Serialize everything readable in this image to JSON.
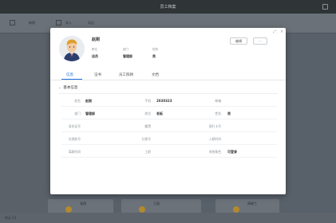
{
  "window": {
    "title": "员工档案"
  },
  "background": {
    "toolbar_items": [
      "新建",
      "导入",
      "导出"
    ],
    "bottom_text": "共计 21",
    "cards": [
      "张翔",
      "王丽",
      "周晓兰"
    ]
  },
  "modal": {
    "profile": {
      "name": "赵刚",
      "fields": [
        {
          "label": "职位",
          "value": "店员"
        },
        {
          "label": "部门",
          "value": "管理部"
        },
        {
          "label": "性别",
          "value": "男"
        }
      ]
    },
    "buttons": {
      "edit": "编辑",
      "more": "···"
    },
    "tabs": [
      "信息",
      "证书",
      "员工照顾",
      "文档"
    ],
    "section_title": "基本信息",
    "rows": [
      [
        {
          "label": "姓名",
          "value": "赵刚"
        },
        {
          "label": "手机",
          "value": "2020323"
        },
        {
          "label": "邮箱",
          "value": ""
        }
      ],
      [
        {
          "label": "部门",
          "value": "管理部"
        },
        {
          "label": "岗位",
          "value": "老板"
        },
        {
          "label": "性别",
          "value": "男"
        }
      ],
      [
        {
          "label": "身份证号",
          "value": ""
        },
        {
          "label": "籍贯",
          "value": ""
        },
        {
          "label": "银行卡号",
          "value": ""
        }
      ],
      [
        {
          "label": "社保账号",
          "value": ""
        },
        {
          "label": "社保号",
          "value": ""
        },
        {
          "label": "入职时间",
          "value": ""
        }
      ],
      [
        {
          "label": "离职时间",
          "value": ""
        },
        {
          "label": "工龄",
          "value": ""
        },
        {
          "label": "系统角色",
          "value": "可登录"
        }
      ]
    ]
  }
}
